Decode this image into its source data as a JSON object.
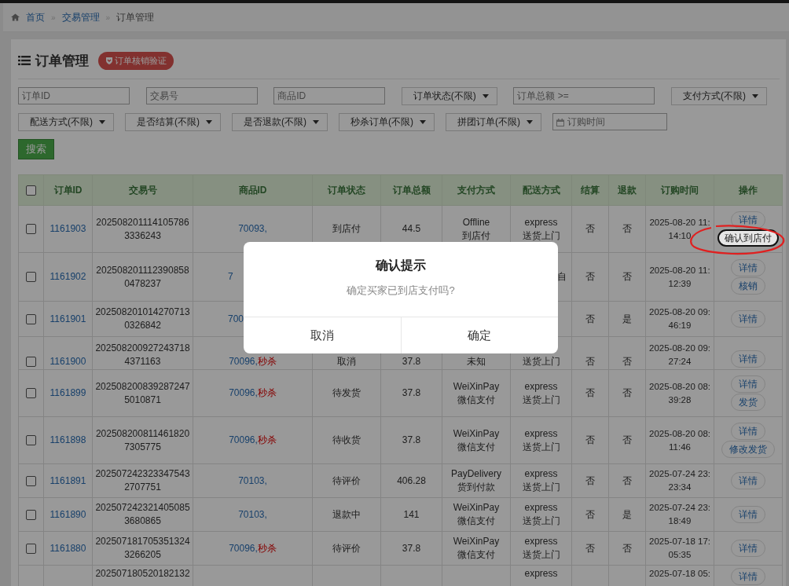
{
  "breadcrumb": {
    "items": [
      {
        "label": "首页",
        "link": true
      },
      {
        "label": "交易管理",
        "link": true
      },
      {
        "label": "订单管理",
        "link": false
      }
    ],
    "separator": "»"
  },
  "panel": {
    "title": "订单管理",
    "badge": "订单核销验证"
  },
  "filters": [
    [
      {
        "kind": "input",
        "placeholder": "订单ID"
      },
      {
        "kind": "input",
        "placeholder": "交易号"
      },
      {
        "kind": "input",
        "placeholder": "商品ID"
      },
      {
        "kind": "select",
        "label": "订单状态(不限)"
      },
      {
        "kind": "amount",
        "placeholder": "订单总额 >="
      },
      {
        "kind": "select",
        "label": "支付方式(不限)"
      }
    ],
    [
      {
        "kind": "select",
        "label": "配送方式(不限)"
      },
      {
        "kind": "select",
        "label": "是否结算(不限)"
      },
      {
        "kind": "select",
        "label": "是否退款(不限)"
      },
      {
        "kind": "select",
        "label": "秒杀订单(不限)"
      },
      {
        "kind": "select",
        "label": "拼团订单(不限)"
      },
      {
        "kind": "date",
        "placeholder": "订购时间"
      }
    ]
  ],
  "search_button": "搜索",
  "table": {
    "select_all": {
      "checked": false
    },
    "columns": [
      "订单ID",
      "交易号",
      "商品ID",
      "订单状态",
      "订单总额",
      "支付方式",
      "配送方式",
      "结算",
      "退款",
      "订购时间",
      "操作"
    ],
    "rows": [
      {
        "checked": false,
        "id": "1161903",
        "trade_no": "2025082011141057863336243",
        "product": {
          "id": "70093,"
        },
        "status": "到店付",
        "total": "44.5",
        "payment": {
          "code": "Offline",
          "name": "到店付"
        },
        "delivery": {
          "code": "express",
          "name": "送货上门"
        },
        "settled": "否",
        "refund": "否",
        "time": "2025-08-20 11:14:10",
        "actions": [
          {
            "label": "详情",
            "highlighted": false
          },
          {
            "label": "确认到店付",
            "highlighted": true
          }
        ]
      },
      {
        "checked": false,
        "under_dialog": true,
        "id": "1161902",
        "trade_no": "2025082011123908580478237",
        "product": {
          "id": "7"
        },
        "delivery": {
          "name": "自"
        },
        "settled": "否",
        "refund": "否",
        "time": "2025-08-20 11:12:39",
        "actions": [
          {
            "label": "详情",
            "highlighted": false
          },
          {
            "label": "核销",
            "highlighted": false
          }
        ]
      },
      {
        "checked": false,
        "under_dialog": true,
        "id": "1161901",
        "trade_no": "2025082010142707130326842",
        "product": {
          "id": "700"
        },
        "settled": "否",
        "refund": "是",
        "time": "2025-08-20 09:46:19",
        "actions": [
          {
            "label": "详情",
            "highlighted": false
          }
        ]
      },
      {
        "checked": false,
        "below_dialog_edge": true,
        "id": "1161900",
        "trade_no": "2025082009272437184371163",
        "product": {
          "id": "70096,",
          "flash": "秒杀"
        },
        "status": "取消",
        "total": "37.8",
        "payment": {
          "name": "未知"
        },
        "delivery": {
          "name": "送货上门"
        },
        "settled": "否",
        "refund": "否",
        "time": "2025-08-20 09:27:24",
        "actions": [
          {
            "label": "详情",
            "highlighted": false
          }
        ]
      },
      {
        "checked": false,
        "id": "1161899",
        "trade_no": "2025082008392872475010871",
        "product": {
          "id": "70096,",
          "flash": "秒杀"
        },
        "status": "待发货",
        "total": "37.8",
        "payment": {
          "code": "WeiXinPay",
          "name": "微信支付"
        },
        "delivery": {
          "code": "express",
          "name": "送货上门"
        },
        "settled": "否",
        "refund": "否",
        "time": "2025-08-20 08:39:28",
        "actions": [
          {
            "label": "详情",
            "highlighted": false
          },
          {
            "label": "发货",
            "highlighted": false
          }
        ]
      },
      {
        "checked": false,
        "id": "1161898",
        "trade_no": "2025082008114618207305775",
        "product": {
          "id": "70096,",
          "flash": "秒杀"
        },
        "status": "待收货",
        "total": "37.8",
        "payment": {
          "code": "WeiXinPay",
          "name": "微信支付"
        },
        "delivery": {
          "code": "express",
          "name": "送货上门"
        },
        "settled": "否",
        "refund": "否",
        "time": "2025-08-20 08:11:46",
        "actions": [
          {
            "label": "详情",
            "highlighted": false
          },
          {
            "label": "修改发货",
            "highlighted": false
          }
        ]
      },
      {
        "checked": false,
        "id": "1161891",
        "trade_no": "2025072423233475432707751",
        "product": {
          "id": "70103,"
        },
        "status": "待评价",
        "total": "406.28",
        "payment": {
          "code": "PayDelivery",
          "name": "货到付款"
        },
        "delivery": {
          "code": "express",
          "name": "送货上门"
        },
        "settled": "否",
        "refund": "否",
        "time": "2025-07-24 23:23:34",
        "actions": [
          {
            "label": "详情",
            "highlighted": false
          }
        ]
      },
      {
        "checked": false,
        "id": "1161890",
        "trade_no": "2025072423214050853680865",
        "product": {
          "id": "70103,"
        },
        "status": "退款中",
        "total": "141",
        "payment": {
          "code": "WeiXinPay",
          "name": "微信支付"
        },
        "delivery": {
          "code": "express",
          "name": "送货上门"
        },
        "settled": "否",
        "refund": "是",
        "time": "2025-07-24 23:18:49",
        "actions": [
          {
            "label": "详情",
            "highlighted": false
          }
        ]
      },
      {
        "checked": false,
        "id": "1161880",
        "trade_no": "2025071817053513243266205",
        "product": {
          "id": "70096,",
          "flash": "秒杀"
        },
        "status": "待评价",
        "total": "37.8",
        "payment": {
          "code": "WeiXinPay",
          "name": "微信支付"
        },
        "delivery": {
          "code": "express",
          "name": "送货上门"
        },
        "settled": "否",
        "refund": "否",
        "time": "2025-07-18 17:05:35",
        "actions": [
          {
            "label": "详情",
            "highlighted": false
          }
        ]
      },
      {
        "trade_no": "202507180520182132",
        "delivery": {
          "code": "express"
        },
        "time": "2025-07-18 05:",
        "actions": [
          {
            "label": "详情",
            "highlighted": false
          }
        ]
      }
    ]
  },
  "dialog": {
    "title": "确认提示",
    "message": "确定买家已到店支付吗?",
    "buttons": [
      "取消",
      "确定"
    ]
  }
}
